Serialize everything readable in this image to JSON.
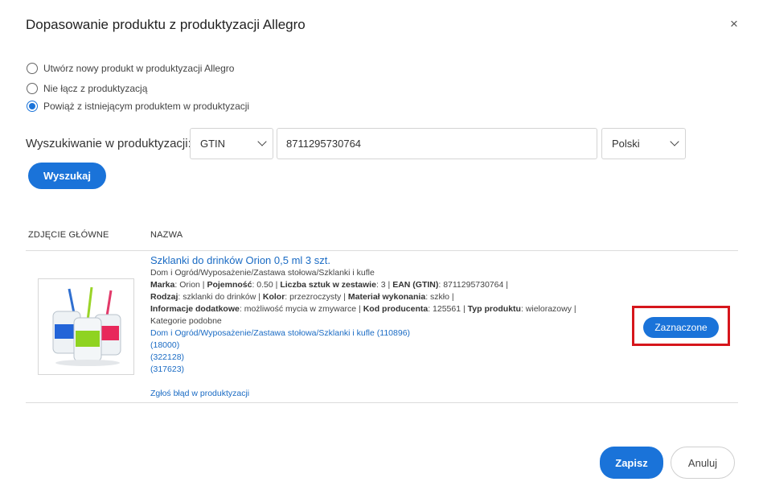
{
  "dialog": {
    "title": "Dopasowanie produktu z produktyzacji Allegro",
    "close_glyph": "×"
  },
  "options": [
    {
      "label": "Utwórz nowy produkt w produktyzacji Allegro",
      "checked": false
    },
    {
      "label": "Nie łącz z produktyzacją",
      "checked": false
    },
    {
      "label": "Powiąż z istniejącym produktem w produktyzacji",
      "checked": true
    }
  ],
  "search": {
    "label": "Wyszukiwanie w produktyzacji:",
    "type_value": "GTIN",
    "query_value": "8711295730764",
    "language_value": "Polski",
    "button_label": "Wyszukaj"
  },
  "table": {
    "col_image": "ZDJĘCIE GŁÓWNE",
    "col_name": "NAZWA"
  },
  "product": {
    "name": "Szklanki do drinków Orion 0,5 ml 3 szt.",
    "category_path": "Dom i Ogród/Wyposażenie/Zastawa stołowa/Szklanki i kufle",
    "attr_line1": [
      {
        "k": "Marka",
        "v": ": Orion |"
      },
      {
        "k": "Pojemność",
        "v": ": 0.50 |"
      },
      {
        "k": "Liczba sztuk w zestawie",
        "v": ": 3 |"
      },
      {
        "k": "EAN (GTIN)",
        "v": ": 8711295730764 |"
      }
    ],
    "attr_line2": [
      {
        "k": "Rodzaj",
        "v": ": szklanki do drinków |"
      },
      {
        "k": "Kolor",
        "v": ": przezroczysty |"
      },
      {
        "k": "Materiał wykonania",
        "v": ": szkło |"
      }
    ],
    "attr_line3": [
      {
        "k": "Informacje dodatkowe",
        "v": ": możliwość mycia w zmywarce |"
      },
      {
        "k": "Kod producenta",
        "v": ": 125561 |"
      },
      {
        "k": "Typ produktu",
        "v": ": wielorazowy |"
      }
    ],
    "similar_label": "Kategorie podobne",
    "similar_links": [
      "Dom i Ogród/Wyposażenie/Zastawa stołowa/Szklanki i kufle (110896)",
      "(18000)",
      "(322128)",
      "(317623)"
    ],
    "report_link": "Zgłoś błąd w produktyzacji",
    "image_icon": "glass-jars-image",
    "selected_button": "Zaznaczone"
  },
  "footer": {
    "save_label": "Zapisz",
    "cancel_label": "Anuluj"
  },
  "colors": {
    "accent": "#1a73d9",
    "link": "#1a6bc4",
    "highlight_border": "#d6161c"
  }
}
